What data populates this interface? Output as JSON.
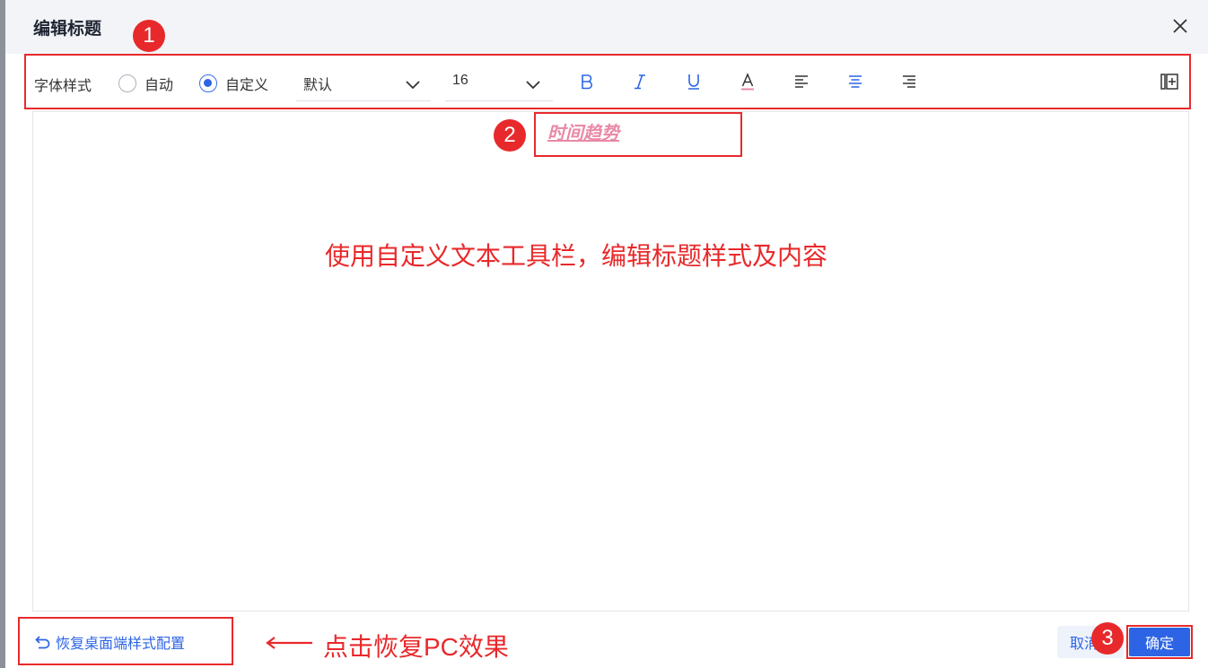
{
  "dialog": {
    "title": "编辑标题"
  },
  "toolbar": {
    "font_style_label": "字体样式",
    "radio_auto": "自动",
    "radio_custom": "自定义",
    "selected_mode": "自定义",
    "font_family": "默认",
    "font_size": "16"
  },
  "editor": {
    "title_text": "时间趋势",
    "title_color": "#e98aa6"
  },
  "annotations": {
    "badge1": "1",
    "badge2": "2",
    "badge3": "3",
    "center_note": "使用自定义文本工具栏，编辑标题样式及内容",
    "restore_note": "点击恢复PC效果",
    "color": "#e8292b"
  },
  "footer": {
    "restore_label": "恢复桌面端样式配置",
    "cancel_label": "取消",
    "ok_label": "确定"
  },
  "colors": {
    "accent": "#2d64e6",
    "header_bg": "#f3f4f7"
  }
}
